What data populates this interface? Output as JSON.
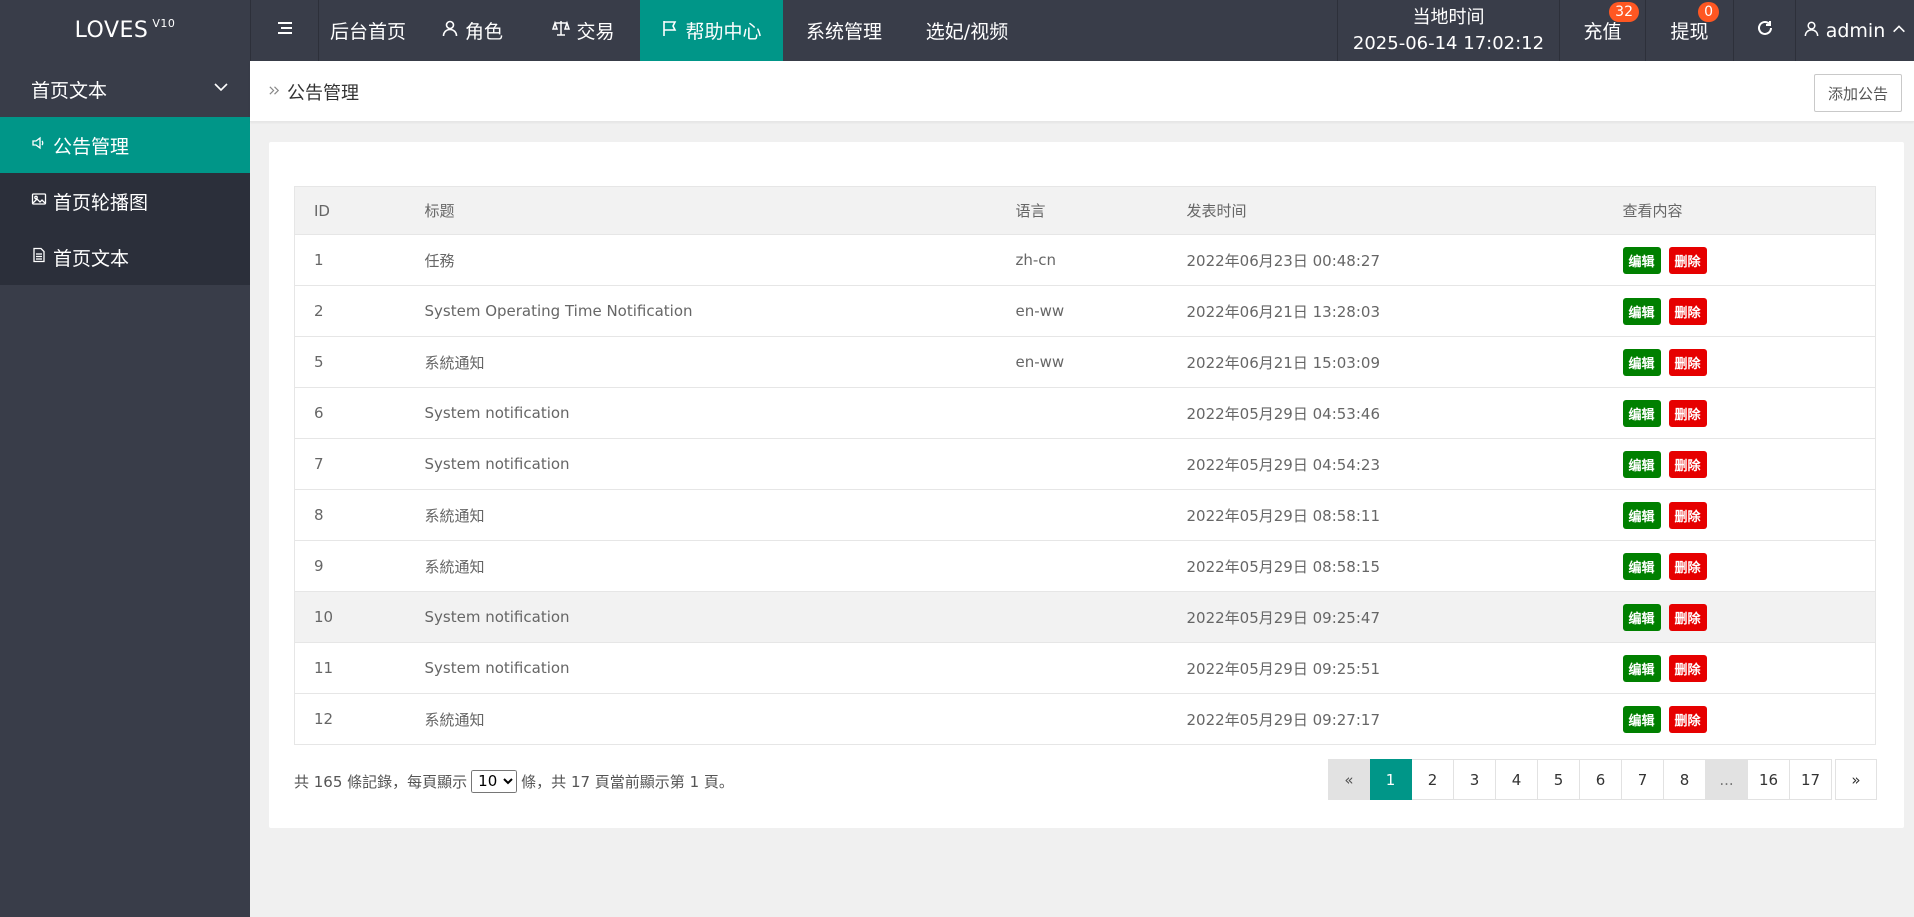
{
  "brand": {
    "name": "LOVES",
    "version": "V10"
  },
  "nav": [
    {
      "label": "后台首页",
      "icon": ""
    },
    {
      "label": "角色",
      "icon": "user-icon"
    },
    {
      "label": "交易",
      "icon": "scale-icon"
    },
    {
      "label": "帮助中心",
      "icon": "flag-icon",
      "active": true
    },
    {
      "label": "系统管理",
      "icon": ""
    },
    {
      "label": "选妃/视频",
      "icon": ""
    }
  ],
  "header": {
    "time_label": "当地时间",
    "time_value": "2025-06-14 17:02:12",
    "recharge_label": "充值",
    "recharge_badge": "32",
    "withdraw_label": "提现",
    "withdraw_badge": "0",
    "user": "admin"
  },
  "sidebar": {
    "group_label": "首页文本",
    "items": [
      {
        "label": "公告管理",
        "icon": "speaker-icon",
        "active": true
      },
      {
        "label": "首页轮播图",
        "icon": "image-icon"
      },
      {
        "label": "首页文本",
        "icon": "document-icon"
      }
    ]
  },
  "breadcrumb": "公告管理",
  "add_button": "添加公告",
  "table": {
    "headers": [
      "ID",
      "标题",
      "语言",
      "发表时间",
      "查看内容"
    ],
    "edit_label": "编辑",
    "delete_label": "删除",
    "rows": [
      {
        "id": "1",
        "title": "任務",
        "lang": "zh-cn",
        "time": "2022年06月23日 00:48:27"
      },
      {
        "id": "2",
        "title": "System Operating Time Notification",
        "lang": "en-ww",
        "time": "2022年06月21日 13:28:03"
      },
      {
        "id": "5",
        "title": "系統通知",
        "lang": "en-ww",
        "time": "2022年06月21日 15:03:09"
      },
      {
        "id": "6",
        "title": "System notification",
        "lang": "",
        "time": "2022年05月29日 04:53:46"
      },
      {
        "id": "7",
        "title": "System notification",
        "lang": "",
        "time": "2022年05月29日 04:54:23"
      },
      {
        "id": "8",
        "title": "系統通知",
        "lang": "",
        "time": "2022年05月29日 08:58:11"
      },
      {
        "id": "9",
        "title": "系統通知",
        "lang": "",
        "time": "2022年05月29日 08:58:15"
      },
      {
        "id": "10",
        "title": "System notification",
        "lang": "",
        "time": "2022年05月29日 09:25:47",
        "highlight": true
      },
      {
        "id": "11",
        "title": "System notification",
        "lang": "",
        "time": "2022年05月29日 09:25:51"
      },
      {
        "id": "12",
        "title": "系統通知",
        "lang": "",
        "time": "2022年05月29日 09:27:17"
      }
    ]
  },
  "pagination": {
    "info_prefix": "共 165 條記錄，每頁顯示",
    "page_size": "10",
    "info_suffix": "條，共 17 頁當前顯示第 1 頁。",
    "prev": "«",
    "next": "»",
    "pages": [
      "1",
      "2",
      "3",
      "4",
      "5",
      "6",
      "7",
      "8",
      "...",
      "16",
      "17"
    ],
    "current": "1"
  },
  "colors": {
    "header_bg": "#393d49",
    "accent": "#009688",
    "edit": "#008000",
    "delete": "#e60000",
    "badge": "#ff5722"
  }
}
